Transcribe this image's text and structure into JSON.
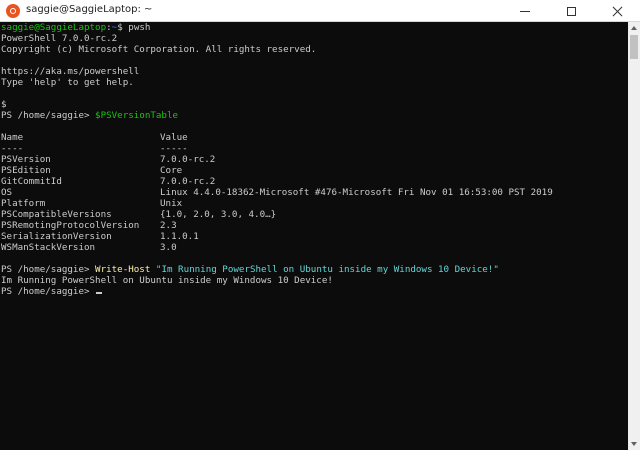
{
  "window": {
    "title": "saggie@SaggieLaptop: ~",
    "icon": "ubuntu-icon",
    "controls": [
      "minimize-icon",
      "maximize-icon",
      "close-icon"
    ]
  },
  "colors": {
    "background": "#0c0c0c",
    "text": "#cccccc",
    "prompt_user": "#16c60c",
    "prompt_path": "#3b78ff",
    "variable": "#16c60c",
    "command": "#f9f1a5",
    "string": "#61d6d6"
  },
  "terminal": {
    "bash_prompt_user": "saggie@SaggieLaptop",
    "bash_prompt_sep": ":",
    "bash_prompt_path": "~",
    "bash_prompt_end": "$ ",
    "bash_command": "pwsh",
    "banner": {
      "version": "PowerShell 7.0.0-rc.2",
      "copyright": "Copyright (c) Microsoft Corporation. All rights reserved.",
      "url": "https://aka.ms/powershell",
      "help": "Type 'help' to get help."
    },
    "stray_line": "$",
    "prompt": "PS /home/saggie> ",
    "command1": "$PSVersionTable",
    "table": {
      "header_name": "Name",
      "header_value": "Value",
      "rule_name": "----",
      "rule_value": "-----",
      "rows": [
        {
          "name": "PSVersion",
          "value": "7.0.0-rc.2"
        },
        {
          "name": "PSEdition",
          "value": "Core"
        },
        {
          "name": "GitCommitId",
          "value": "7.0.0-rc.2"
        },
        {
          "name": "OS",
          "value": "Linux 4.4.0-18362-Microsoft #476-Microsoft Fri Nov 01 16:53:00 PST 2019"
        },
        {
          "name": "Platform",
          "value": "Unix"
        },
        {
          "name": "PSCompatibleVersions",
          "value": "{1.0, 2.0, 3.0, 4.0…}"
        },
        {
          "name": "PSRemotingProtocolVersion",
          "value": "2.3"
        },
        {
          "name": "SerializationVersion",
          "value": "1.1.0.1"
        },
        {
          "name": "WSManStackVersion",
          "value": "3.0"
        }
      ]
    },
    "command2_name": "Write-Host",
    "command2_arg": "\"Im Running PowerShell on Ubuntu inside my Windows 10 Device!\"",
    "output2": "Im Running PowerShell on Ubuntu inside my Windows 10 Device!"
  }
}
